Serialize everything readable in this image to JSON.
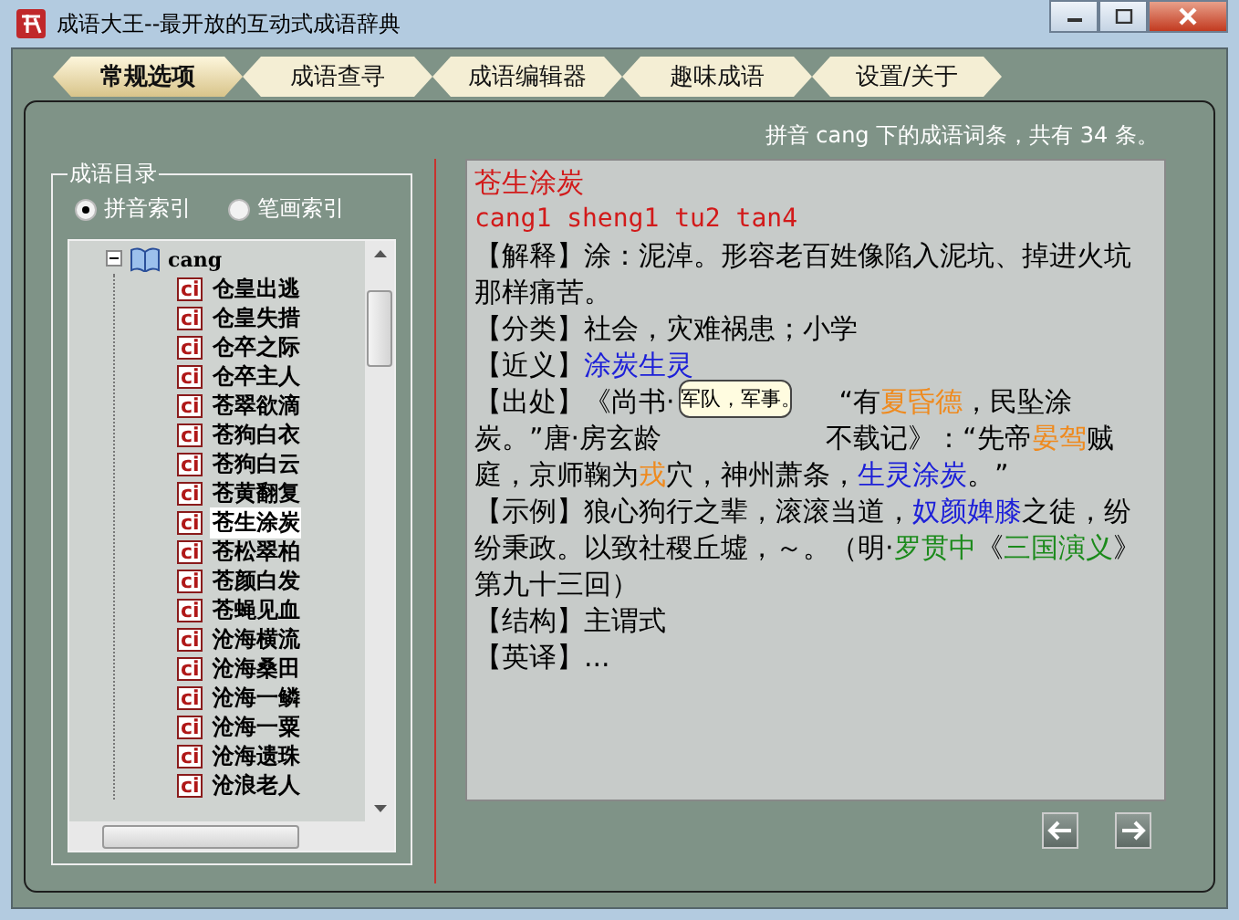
{
  "window": {
    "title": "成语大王--最开放的互动式成语辞典"
  },
  "tabs": [
    {
      "label": "常规选项",
      "selected": true
    },
    {
      "label": "成语查寻",
      "selected": false
    },
    {
      "label": "成语编辑器",
      "selected": false
    },
    {
      "label": "趣味成语",
      "selected": false
    },
    {
      "label": "设置/关于",
      "selected": false
    }
  ],
  "summary": "拼音 cang 下的成语词条，共有 34 条。",
  "catalog": {
    "title": "成语目录",
    "index_options": [
      {
        "label": "拼音索引",
        "selected": true
      },
      {
        "label": "笔画索引",
        "selected": false
      }
    ],
    "tree": [
      {
        "label": "cang",
        "expanded": true,
        "children": [
          {
            "icon": "ci",
            "label": "仓皇出逃",
            "selected": false
          },
          {
            "icon": "ci",
            "label": "仓皇失措",
            "selected": false
          },
          {
            "icon": "ci",
            "label": "仓卒之际",
            "selected": false
          },
          {
            "icon": "ci",
            "label": "仓卒主人",
            "selected": false
          },
          {
            "icon": "ci",
            "label": "苍翠欲滴",
            "selected": false
          },
          {
            "icon": "ci",
            "label": "苍狗白衣",
            "selected": false
          },
          {
            "icon": "ci",
            "label": "苍狗白云",
            "selected": false
          },
          {
            "icon": "ci",
            "label": "苍黄翻复",
            "selected": false
          },
          {
            "icon": "ci",
            "label": "苍生涂炭",
            "selected": true
          },
          {
            "icon": "ci",
            "label": "苍松翠柏",
            "selected": false
          },
          {
            "icon": "ci",
            "label": "苍颜白发",
            "selected": false
          },
          {
            "icon": "ci",
            "label": "苍蝇见血",
            "selected": false
          },
          {
            "icon": "ci",
            "label": "沧海横流",
            "selected": false
          },
          {
            "icon": "ci",
            "label": "沧海桑田",
            "selected": false
          },
          {
            "icon": "ci",
            "label": "沧海一鳞",
            "selected": false
          },
          {
            "icon": "ci",
            "label": "沧海一粟",
            "selected": false
          },
          {
            "icon": "ci",
            "label": "沧海遗珠",
            "selected": false
          },
          {
            "icon": "ci",
            "label": "沧浪老人",
            "selected": false
          }
        ]
      }
    ]
  },
  "entry": {
    "title": "苍生涂炭",
    "pinyin": "cang1 sheng1 tu2 tan4",
    "paragraphs": [
      {
        "segments": [
          {
            "kind": "plain",
            "text": "【解释】涂：泥淖。形容老百姓像陷入泥坑、掉进火坑那样痛苦。"
          }
        ]
      },
      {
        "segments": [
          {
            "kind": "plain",
            "text": "【分类】社会，灾难祸患；小学"
          }
        ]
      },
      {
        "segments": [
          {
            "kind": "plain",
            "text": "【近义】"
          },
          {
            "kind": "blue",
            "text": "涂炭生灵"
          }
        ]
      },
      {
        "segments": [
          {
            "kind": "plain",
            "text": "【出处】《尚书·"
          },
          {
            "kind": "covered"
          },
          {
            "kind": "plain",
            "text": "“有"
          },
          {
            "kind": "orange",
            "text": "夏昏德"
          },
          {
            "kind": "plain",
            "text": "，民坠涂炭。”唐·房玄龄"
          },
          {
            "kind": "covered"
          },
          {
            "kind": "plain",
            "text": "不载记》：“先帝"
          },
          {
            "kind": "orange",
            "text": "晏驾"
          },
          {
            "kind": "plain",
            "text": "贼庭，京师鞠为"
          },
          {
            "kind": "orange",
            "text": "戎"
          },
          {
            "kind": "plain",
            "text": "穴，神州萧条，"
          },
          {
            "kind": "blue",
            "text": "生灵涂炭"
          },
          {
            "kind": "plain",
            "text": "。”"
          }
        ]
      },
      {
        "segments": [
          {
            "kind": "plain",
            "text": "【示例】狼心狗行之辈，滚滚当道，"
          },
          {
            "kind": "blue",
            "text": "奴颜婢膝"
          },
          {
            "kind": "plain",
            "text": "之徒，纷纷秉政。以致社稷丘墟，～。（明·"
          },
          {
            "kind": "green",
            "text": "罗贯中"
          },
          {
            "kind": "plain",
            "text": "《"
          },
          {
            "kind": "green",
            "text": "三国演义"
          },
          {
            "kind": "plain",
            "text": "》第九十三回）"
          }
        ]
      },
      {
        "segments": [
          {
            "kind": "plain",
            "text": "【结构】主谓式"
          }
        ]
      },
      {
        "segments": [
          {
            "kind": "plain",
            "text": "【英译】..."
          }
        ]
      }
    ]
  },
  "tooltip": {
    "text": "军队，军事。"
  }
}
